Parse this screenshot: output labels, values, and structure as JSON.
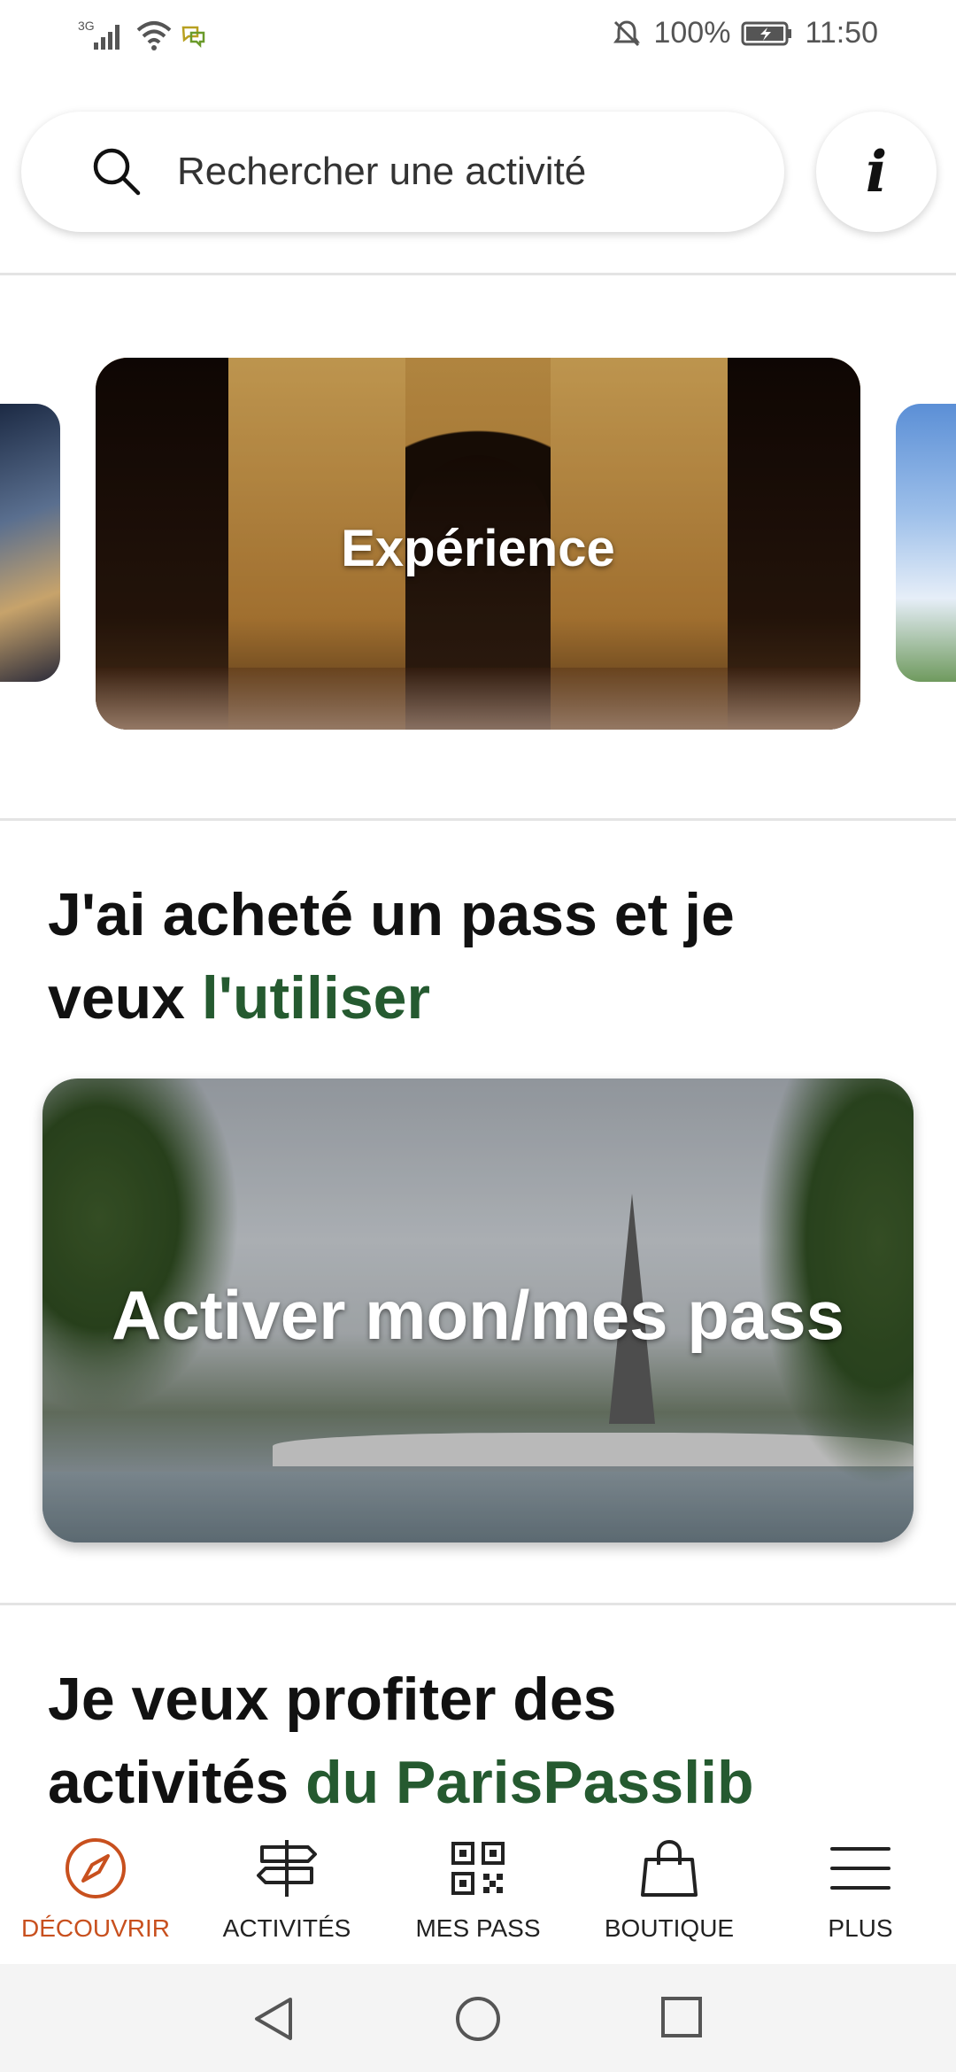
{
  "status_bar": {
    "network": "3G",
    "battery": "100%",
    "time": "11:50",
    "icons": [
      "signal-icon",
      "wifi-icon",
      "chat-icon",
      "mute-icon",
      "battery-icon"
    ]
  },
  "search": {
    "placeholder": "Rechercher une activité",
    "info_label": "i"
  },
  "carousel": {
    "main_card_label": "Expérience"
  },
  "section_use": {
    "title_part1": "J'ai acheté un pass et je",
    "title_part2": "veux ",
    "title_accent": "l'utiliser",
    "card_label": "Activer mon/mes pass"
  },
  "section_enjoy": {
    "title_part1": "Je veux profiter des",
    "title_part2": "activités ",
    "title_accent": "du ParisPasslib"
  },
  "bottom_nav": {
    "items": [
      {
        "label": "DÉCOUVRIR",
        "icon": "compass-icon",
        "active": true
      },
      {
        "label": "ACTIVITÉS",
        "icon": "signpost-icon",
        "active": false
      },
      {
        "label": "MES PASS",
        "icon": "qr-code-icon",
        "active": false
      },
      {
        "label": "BOUTIQUE",
        "icon": "shopping-bag-icon",
        "active": false
      },
      {
        "label": "PLUS",
        "icon": "menu-icon",
        "active": false
      }
    ]
  },
  "colors": {
    "accent_green": "#255a30",
    "active_orange": "#c8501e"
  }
}
